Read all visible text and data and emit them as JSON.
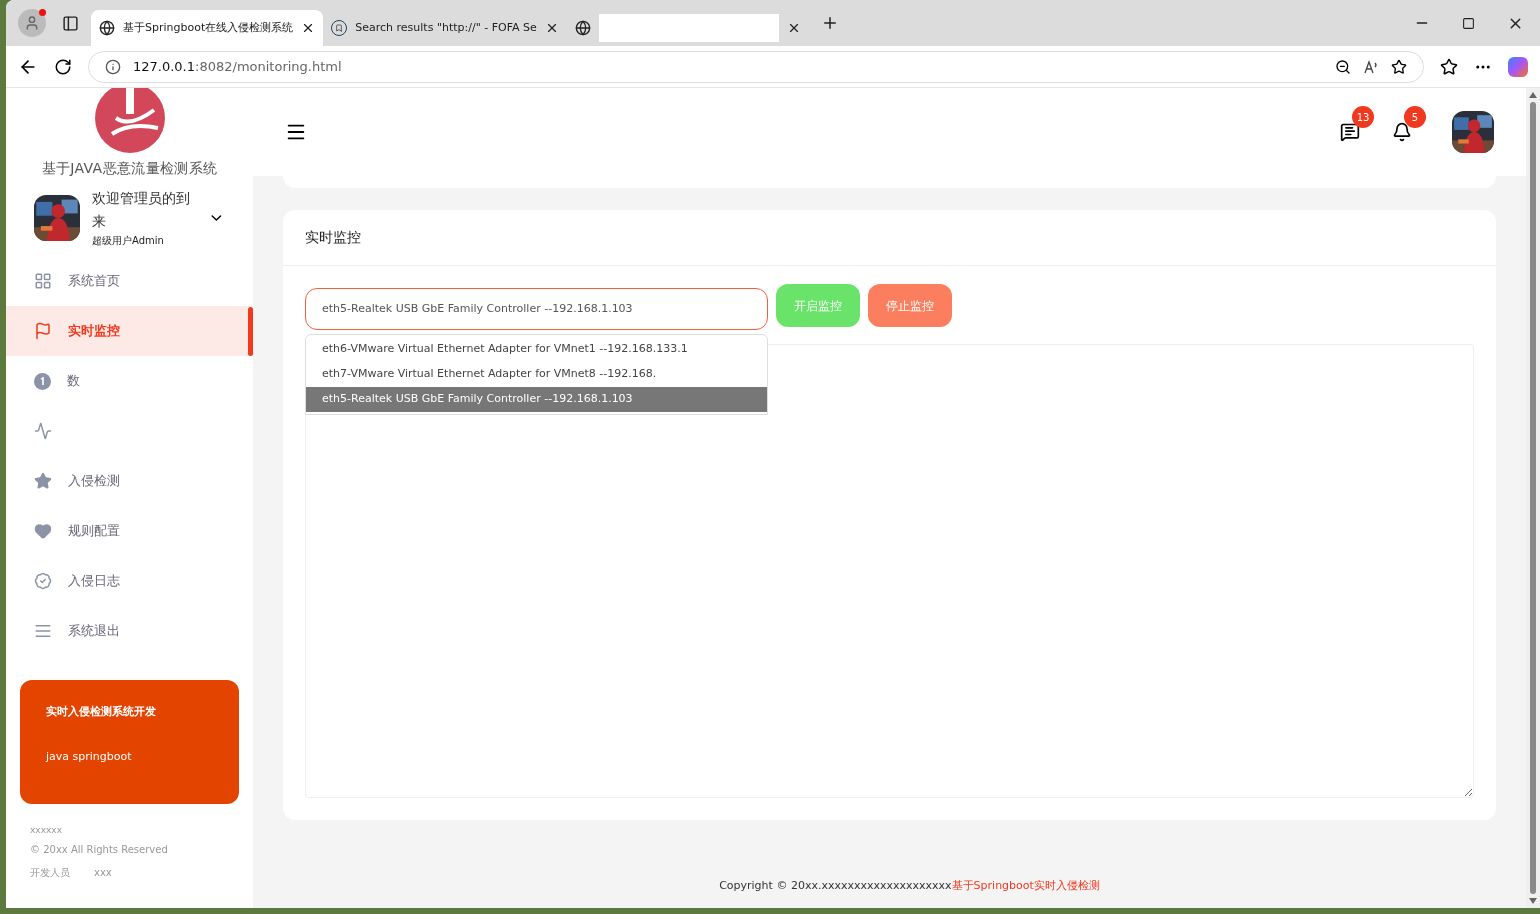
{
  "browser": {
    "tabs": [
      {
        "title": "基于Springboot在线入侵检测系统",
        "selected": true
      },
      {
        "title": "Search results \"http://\" - FOFA Se",
        "selected": false
      },
      {
        "selected": false
      }
    ],
    "address": {
      "host": "127.0.0.1",
      "path": ":8082/monitoring.html"
    }
  },
  "sidebar": {
    "brand": "基于JAVA恶意流量检测系统",
    "user": {
      "greeting": "欢迎管理员的到来",
      "role": "超级用户Admin"
    },
    "items": [
      {
        "label": "系统首页",
        "selected": false
      },
      {
        "label": "实时监控",
        "selected": true
      },
      {
        "label": "数",
        "selected": false
      },
      {
        "selected": false
      },
      {
        "label": "入侵检测",
        "selected": false
      },
      {
        "label": "规则配置",
        "selected": false
      },
      {
        "label": "入侵日志",
        "selected": false
      },
      {
        "label": "系统退出",
        "selected": false
      }
    ],
    "promo": {
      "title": "实时入侵检测系统开发",
      "subtitle": "java springboot"
    },
    "footer": {
      "name": "xxxxxx",
      "rights": "© 20xx All Rights Reserved",
      "developer_label": "开发人员",
      "developer": "xxx"
    }
  },
  "header": {
    "messages_count": "13",
    "notifications_count": "5"
  },
  "panel": {
    "title": "实时监控",
    "interface": "eth5-Realtek USB GbE Family Controller --192.168.1.103",
    "options": [
      {
        "label": "eth6-VMware Virtual Ethernet Adapter for VMnet1 --192.168.133.1",
        "selected": false
      },
      {
        "label": "eth7-VMware Virtual Ethernet Adapter for VMnet8 --192.168.",
        "selected": false
      },
      {
        "label": "eth5-Realtek USB GbE Family Controller --192.168.1.103",
        "selected": true
      }
    ],
    "start_button": "开启监控",
    "stop_button": "停止监控"
  },
  "footer": {
    "copyright": "Copyright © 20xx.xxxxxxxxxxxxxxxxxxxx",
    "link": "基于Springboot实时入侵检测"
  }
}
